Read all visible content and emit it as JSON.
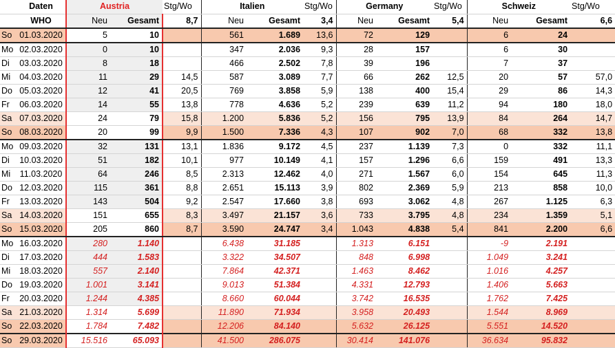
{
  "header": {
    "daten": "Daten",
    "who": "WHO",
    "countries": [
      {
        "name": "Austria",
        "stg_label": "Stg/Wo",
        "neu": "Neu",
        "gesamt": "Gesamt",
        "stg_value": "8,7"
      },
      {
        "name": "Italien",
        "stg_label": "Stg/Wo",
        "neu": "Neu",
        "gesamt": "Gesamt",
        "stg_value": "3,4"
      },
      {
        "name": "Germany",
        "stg_label": "Stg/Wo",
        "neu": "Neu",
        "gesamt": "Gesamt",
        "stg_value": "5,4"
      },
      {
        "name": "Schweiz",
        "stg_label": "Stg/Wo",
        "neu": "Neu",
        "gesamt": "Gesamt",
        "stg_value": "6,6"
      }
    ]
  },
  "rows": [
    {
      "day": "So",
      "date": "01.03.2020",
      "at": [
        "5",
        "10",
        ""
      ],
      "it": [
        "561",
        "1.689",
        "13,6"
      ],
      "de": [
        "72",
        "129",
        ""
      ],
      "ch": [
        "6",
        "24",
        ""
      ]
    },
    {
      "day": "Mo",
      "date": "02.03.2020",
      "at": [
        "0",
        "10",
        ""
      ],
      "it": [
        "347",
        "2.036",
        "9,3"
      ],
      "de": [
        "28",
        "157",
        ""
      ],
      "ch": [
        "6",
        "30",
        ""
      ]
    },
    {
      "day": "Di",
      "date": "03.03.2020",
      "at": [
        "8",
        "18",
        ""
      ],
      "it": [
        "466",
        "2.502",
        "7,8"
      ],
      "de": [
        "39",
        "196",
        ""
      ],
      "ch": [
        "7",
        "37",
        ""
      ]
    },
    {
      "day": "Mi",
      "date": "04.03.2020",
      "at": [
        "11",
        "29",
        "14,5"
      ],
      "it": [
        "587",
        "3.089",
        "7,7"
      ],
      "de": [
        "66",
        "262",
        "12,5"
      ],
      "ch": [
        "20",
        "57",
        "57,0"
      ]
    },
    {
      "day": "Do",
      "date": "05.03.2020",
      "at": [
        "12",
        "41",
        "20,5"
      ],
      "it": [
        "769",
        "3.858",
        "5,9"
      ],
      "de": [
        "138",
        "400",
        "15,4"
      ],
      "ch": [
        "29",
        "86",
        "14,3"
      ]
    },
    {
      "day": "Fr",
      "date": "06.03.2020",
      "at": [
        "14",
        "55",
        "13,8"
      ],
      "it": [
        "778",
        "4.636",
        "5,2"
      ],
      "de": [
        "239",
        "639",
        "11,2"
      ],
      "ch": [
        "94",
        "180",
        "18,0"
      ]
    },
    {
      "day": "Sa",
      "date": "07.03.2020",
      "at": [
        "24",
        "79",
        "15,8"
      ],
      "it": [
        "1.200",
        "5.836",
        "5,2"
      ],
      "de": [
        "156",
        "795",
        "13,9"
      ],
      "ch": [
        "84",
        "264",
        "14,7"
      ]
    },
    {
      "day": "So",
      "date": "08.03.2020",
      "at": [
        "20",
        "99",
        "9,9"
      ],
      "it": [
        "1.500",
        "7.336",
        "4,3"
      ],
      "de": [
        "107",
        "902",
        "7,0"
      ],
      "ch": [
        "68",
        "332",
        "13,8"
      ]
    },
    {
      "day": "Mo",
      "date": "09.03.2020",
      "at": [
        "32",
        "131",
        "13,1"
      ],
      "it": [
        "1.836",
        "9.172",
        "4,5"
      ],
      "de": [
        "237",
        "1.139",
        "7,3"
      ],
      "ch": [
        "0",
        "332",
        "11,1"
      ]
    },
    {
      "day": "Di",
      "date": "10.03.2020",
      "at": [
        "51",
        "182",
        "10,1"
      ],
      "it": [
        "977",
        "10.149",
        "4,1"
      ],
      "de": [
        "157",
        "1.296",
        "6,6"
      ],
      "ch": [
        "159",
        "491",
        "13,3"
      ]
    },
    {
      "day": "Mi",
      "date": "11.03.2020",
      "at": [
        "64",
        "246",
        "8,5"
      ],
      "it": [
        "2.313",
        "12.462",
        "4,0"
      ],
      "de": [
        "271",
        "1.567",
        "6,0"
      ],
      "ch": [
        "154",
        "645",
        "11,3"
      ]
    },
    {
      "day": "Do",
      "date": "12.03.2020",
      "at": [
        "115",
        "361",
        "8,8"
      ],
      "it": [
        "2.651",
        "15.113",
        "3,9"
      ],
      "de": [
        "802",
        "2.369",
        "5,9"
      ],
      "ch": [
        "213",
        "858",
        "10,0"
      ]
    },
    {
      "day": "Fr",
      "date": "13.03.2020",
      "at": [
        "143",
        "504",
        "9,2"
      ],
      "it": [
        "2.547",
        "17.660",
        "3,8"
      ],
      "de": [
        "693",
        "3.062",
        "4,8"
      ],
      "ch": [
        "267",
        "1.125",
        "6,3"
      ]
    },
    {
      "day": "Sa",
      "date": "14.03.2020",
      "at": [
        "151",
        "655",
        "8,3"
      ],
      "it": [
        "3.497",
        "21.157",
        "3,6"
      ],
      "de": [
        "733",
        "3.795",
        "4,8"
      ],
      "ch": [
        "234",
        "1.359",
        "5,1"
      ]
    },
    {
      "day": "So",
      "date": "15.03.2020",
      "at": [
        "205",
        "860",
        "8,7"
      ],
      "it": [
        "3.590",
        "24.747",
        "3,4"
      ],
      "de": [
        "1.043",
        "4.838",
        "5,4"
      ],
      "ch": [
        "841",
        "2.200",
        "6,6"
      ]
    },
    {
      "day": "Mo",
      "date": "16.03.2020",
      "at": [
        "280",
        "1.140",
        ""
      ],
      "it": [
        "6.438",
        "31.185",
        ""
      ],
      "de": [
        "1.313",
        "6.151",
        ""
      ],
      "ch": [
        "-9",
        "2.191",
        ""
      ]
    },
    {
      "day": "Di",
      "date": "17.03.2020",
      "at": [
        "444",
        "1.583",
        ""
      ],
      "it": [
        "3.322",
        "34.507",
        ""
      ],
      "de": [
        "848",
        "6.998",
        ""
      ],
      "ch": [
        "1.049",
        "3.241",
        ""
      ]
    },
    {
      "day": "Mi",
      "date": "18.03.2020",
      "at": [
        "557",
        "2.140",
        ""
      ],
      "it": [
        "7.864",
        "42.371",
        ""
      ],
      "de": [
        "1.463",
        "8.462",
        ""
      ],
      "ch": [
        "1.016",
        "4.257",
        ""
      ]
    },
    {
      "day": "Do",
      "date": "19.03.2020",
      "at": [
        "1.001",
        "3.141",
        ""
      ],
      "it": [
        "9.013",
        "51.384",
        ""
      ],
      "de": [
        "4.331",
        "12.793",
        ""
      ],
      "ch": [
        "1.406",
        "5.663",
        ""
      ]
    },
    {
      "day": "Fr",
      "date": "20.03.2020",
      "at": [
        "1.244",
        "4.385",
        ""
      ],
      "it": [
        "8.660",
        "60.044",
        ""
      ],
      "de": [
        "3.742",
        "16.535",
        ""
      ],
      "ch": [
        "1.762",
        "7.425",
        ""
      ]
    },
    {
      "day": "Sa",
      "date": "21.03.2020",
      "at": [
        "1.314",
        "5.699",
        ""
      ],
      "it": [
        "11.890",
        "71.934",
        ""
      ],
      "de": [
        "3.958",
        "20.493",
        ""
      ],
      "ch": [
        "1.544",
        "8.969",
        ""
      ]
    },
    {
      "day": "So",
      "date": "22.03.2020",
      "at": [
        "1.784",
        "7.482",
        ""
      ],
      "it": [
        "12.206",
        "84.140",
        ""
      ],
      "de": [
        "5.632",
        "26.125",
        ""
      ],
      "ch": [
        "5.551",
        "14.520",
        ""
      ]
    },
    {
      "day": "So",
      "date": "29.03.2020",
      "at": [
        "15.516",
        "65.093",
        ""
      ],
      "it": [
        "41.500",
        "286.075",
        ""
      ],
      "de": [
        "30.414",
        "141.076",
        ""
      ],
      "ch": [
        "36.634",
        "95.832",
        ""
      ]
    }
  ]
}
